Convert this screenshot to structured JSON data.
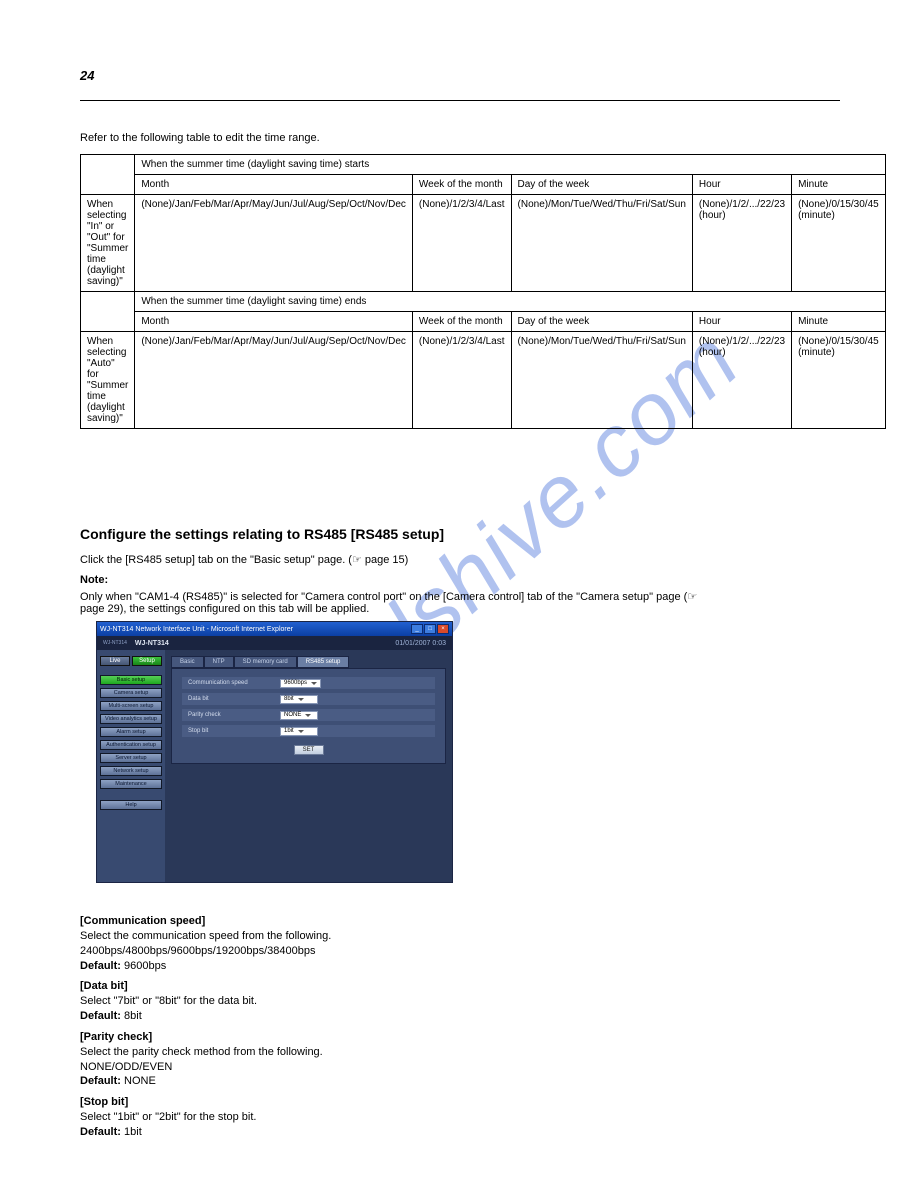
{
  "page_number": "24",
  "intro": "Refer to the following table to edit the time range.",
  "watermark": "manualshive.com",
  "table": {
    "header_row1": [
      "",
      "When the summer time (daylight saving time) starts"
    ],
    "header_row2": [
      "",
      "Month",
      "Week of the month",
      "Day of the week",
      "Hour",
      "Minute"
    ],
    "when_col1": "When selecting \"In\" or \"Out\" for \"Summer time (daylight saving)\"",
    "when_cells": [
      "(None)/Jan/Feb/Mar/Apr/May/Jun/Jul/Aug/Sep/Oct/Nov/Dec",
      "(None)/1/2/3/4/Last",
      "(None)/Mon/Tue/Wed/Thu/Fri/Sat/Sun",
      "(None)/1/2/.../22/23 (hour)",
      "(None)/0/15/30/45 (minute)"
    ],
    "sep_row": [
      "",
      "When the summer time (daylight saving time) ends"
    ],
    "sep_row2": [
      "",
      "Month",
      "Week of the month",
      "Day of the week",
      "Hour",
      "Minute"
    ],
    "auto_col1": "When selecting \"Auto\" for \"Summer time (daylight saving)\"",
    "auto_cells": [
      "(None)/Jan/Feb/Mar/Apr/May/Jun/Jul/Aug/Sep/Oct/Nov/Dec",
      "(None)/1/2/3/4/Last",
      "(None)/Mon/Tue/Wed/Thu/Fri/Sat/Sun",
      "(None)/1/2/.../22/23 (hour)",
      "(None)/0/15/30/45 (minute)"
    ]
  },
  "section": {
    "title": "Configure the settings relating to RS485 [RS485 setup]",
    "desc": "Click the [RS485 setup] tab on the \"Basic setup\" page. (☞ page 15)",
    "note_label": "Note:",
    "note_text": "Only when \"CAM1-4 (RS485)\" is selected for \"Camera control port\" on the [Camera control] tab of the \"Camera setup\" page (☞",
    "note_text2": "page 29), the settings configured on this tab will be applied."
  },
  "app": {
    "window_title": "WJ-NT314 Network Interface Unit - Microsoft Internet Explorer",
    "model_code": "WJ-NT314",
    "brand_line": "WJ-NT314",
    "datetime": "01/01/2007  0:03",
    "modes": {
      "live": "Live",
      "setup": "Setup"
    },
    "sidebar": [
      {
        "label": "Basic setup",
        "active": true
      },
      {
        "label": "Camera setup"
      },
      {
        "label": "Multi-screen setup"
      },
      {
        "label": "Video analytics setup"
      },
      {
        "label": "Alarm setup"
      },
      {
        "label": "Authentication setup"
      },
      {
        "label": "Server setup"
      },
      {
        "label": "Network setup"
      },
      {
        "label": "Maintenance"
      }
    ],
    "help": "Help",
    "tabs": [
      {
        "label": "Basic"
      },
      {
        "label": "NTP"
      },
      {
        "label": "SD memory card"
      },
      {
        "label": "RS485 setup",
        "active": true
      }
    ],
    "form": {
      "rows": [
        {
          "label": "Communication speed",
          "value": "9600bps"
        },
        {
          "label": "Data bit",
          "value": "8bit"
        },
        {
          "label": "Parity check",
          "value": "NONE"
        },
        {
          "label": "Stop bit",
          "value": "1bit"
        }
      ],
      "set": "SET"
    }
  },
  "fields": [
    {
      "name": "[Communication speed]",
      "body": "Select the communication speed from the following.",
      "opts": "2400bps/4800bps/9600bps/19200bps/38400bps",
      "dflt": "9600bps"
    },
    {
      "name": "[Data bit]",
      "body": "Select \"7bit\" or \"8bit\" for the data bit.",
      "dflt": "8bit"
    },
    {
      "name": "[Parity check]",
      "body": "Select the parity check method from the following.",
      "opts": "NONE/ODD/EVEN",
      "dflt": "NONE"
    },
    {
      "name": "[Stop bit]",
      "body": "Select \"1bit\" or \"2bit\" for the stop bit.",
      "dflt": "1bit"
    }
  ],
  "default_label": "Default:"
}
